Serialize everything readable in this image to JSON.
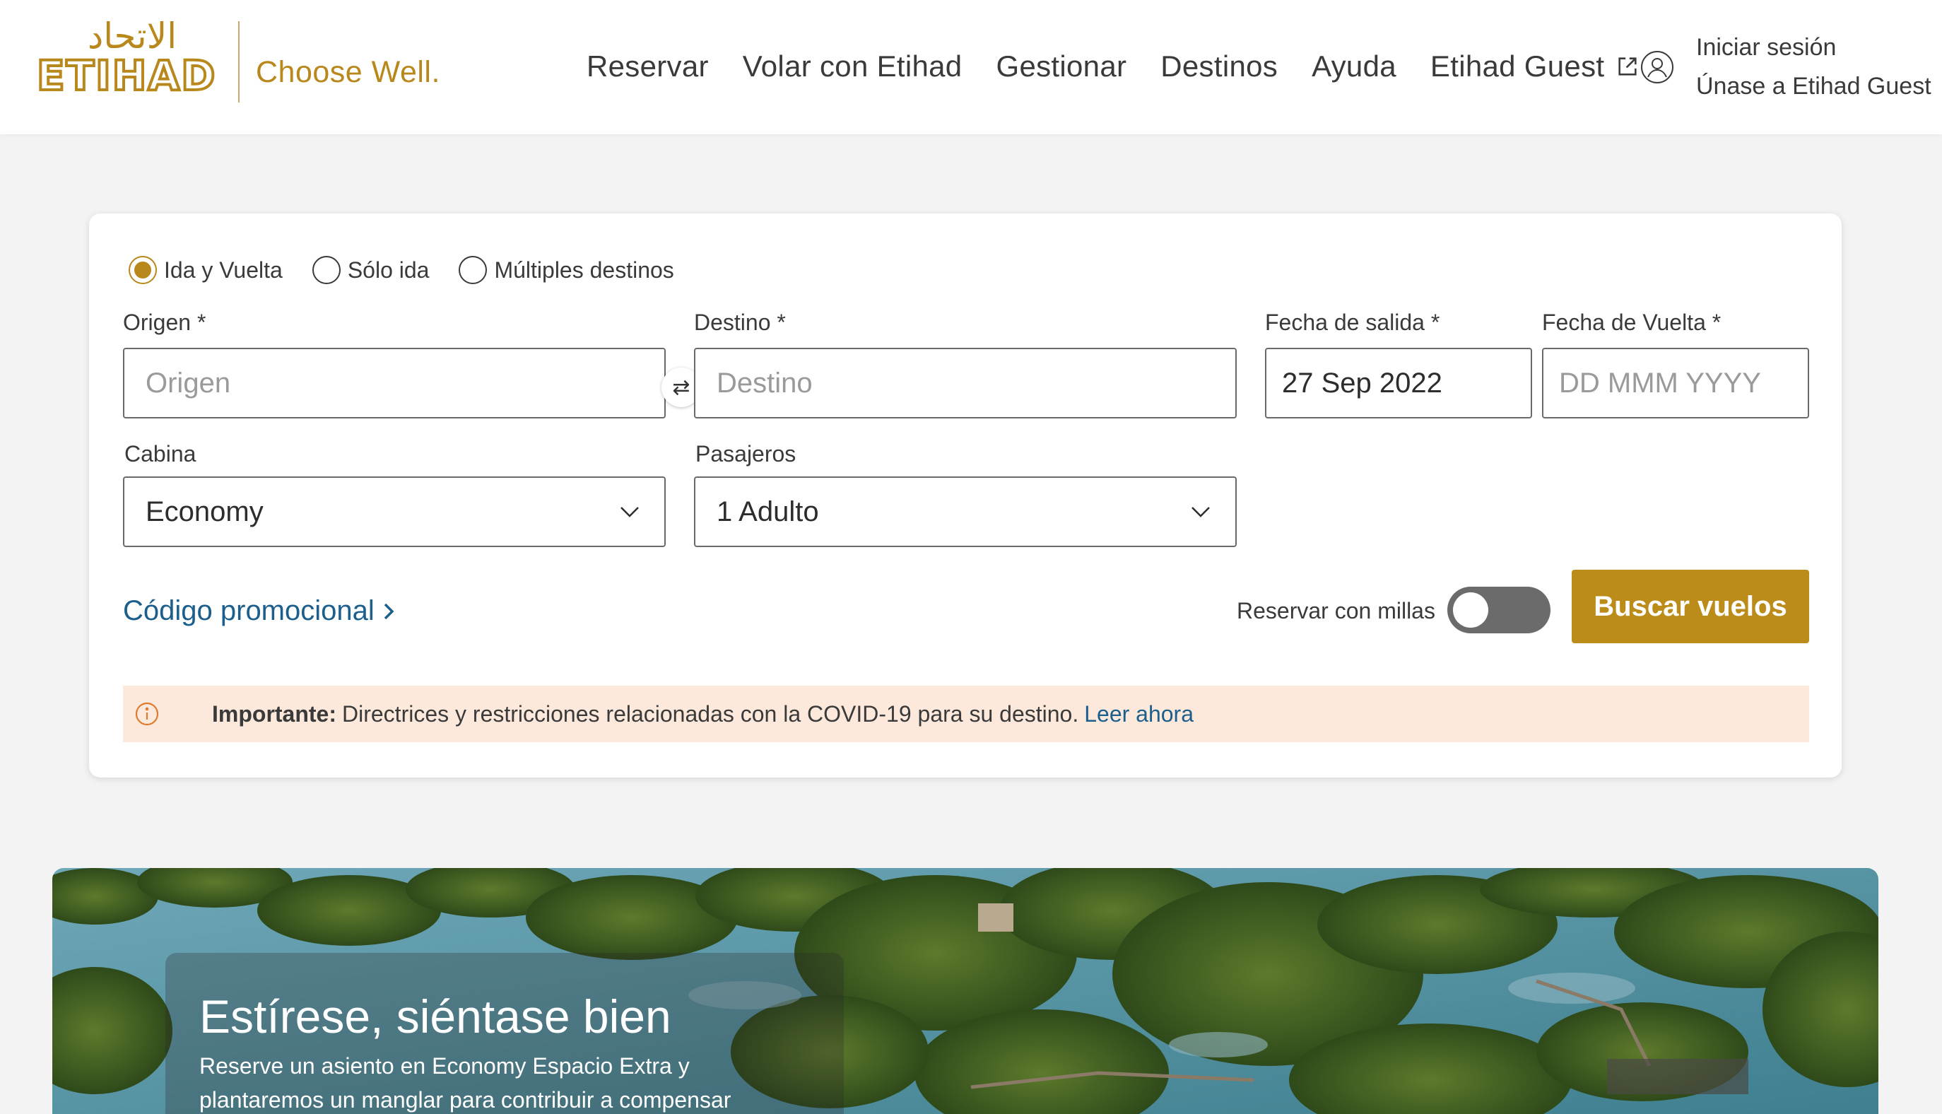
{
  "header": {
    "logo_arabic": "الاتحاد",
    "logo_text": "ETIHAD",
    "tagline": "Choose Well.",
    "nav": [
      "Reservar",
      "Volar con Etihad",
      "Gestionar",
      "Destinos",
      "Ayuda"
    ],
    "nav_guest": "Etihad Guest",
    "sign_in": "Iniciar sesión",
    "join": "Únase a Etihad Guest"
  },
  "booking": {
    "trip_types": [
      {
        "label": "Ida y Vuelta",
        "checked": true
      },
      {
        "label": "Sólo ida",
        "checked": false
      },
      {
        "label": "Múltiples destinos",
        "checked": false
      }
    ],
    "origin_label": "Origen *",
    "origin_placeholder": "Origen",
    "destination_label": "Destino *",
    "destination_placeholder": "Destino",
    "departure_label": "Fecha de salida *",
    "departure_value": "27 Sep 2022",
    "return_label": "Fecha de Vuelta *",
    "return_placeholder": "DD MMM YYYY",
    "cabin_label": "Cabina",
    "cabin_value": "Economy",
    "passengers_label": "Pasajeros",
    "passengers_value": "1 Adulto",
    "promo": "Código promocional",
    "miles_label": "Reservar con millas",
    "miles_enabled": false,
    "search_button": "Buscar vuelos",
    "notice_bold": "Importante:",
    "notice_text": "Directrices y restricciones relacionadas con la COVID-19 para su destino.",
    "notice_link": "Leer ahora"
  },
  "hero": {
    "title": "Estírese, siéntase bien",
    "text": "Reserve un asiento en Economy Espacio Extra y plantaremos un manglar para contribuir a compensar"
  },
  "colors": {
    "brand_gold": "#bc8c1b",
    "link_blue": "#1c5f8c",
    "notice_bg": "#fde9dc"
  }
}
